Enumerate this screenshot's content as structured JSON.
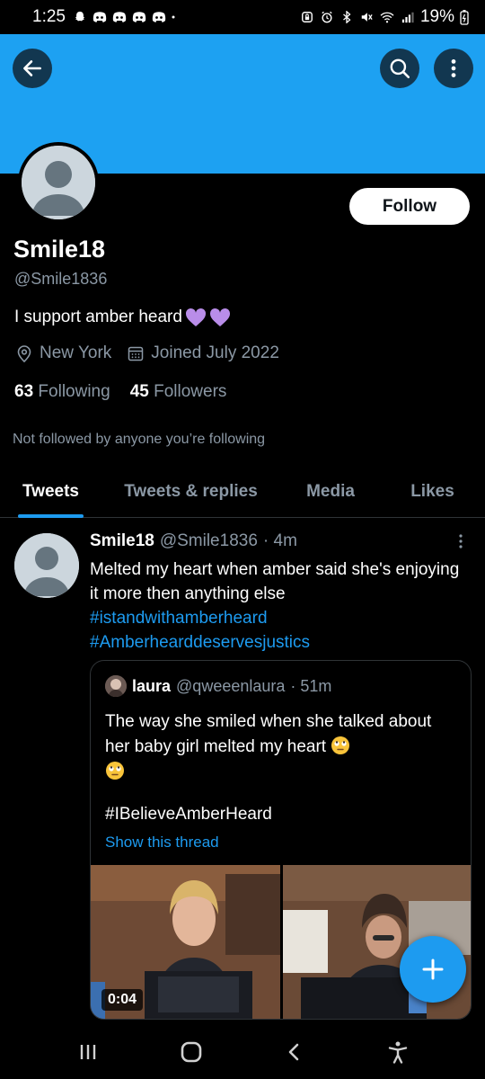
{
  "status_bar": {
    "time": "1:25",
    "battery": "19%",
    "icons": [
      "snapchat-icon",
      "discord-icon",
      "discord-icon",
      "discord-icon",
      "discord-icon",
      "dot-icon",
      "lock-icon",
      "alarm-icon",
      "bluetooth-icon",
      "mute-icon",
      "wifi-icon",
      "signal-icon",
      "battery-charging-icon"
    ]
  },
  "header": {
    "back_icon": "arrow-left-icon",
    "search_icon": "search-icon",
    "more_icon": "more-vertical-icon",
    "banner_color": "#1da1f2"
  },
  "profile": {
    "name": "Smile18",
    "handle": "@Smile1836",
    "bio": "I support amber heard",
    "bio_emojis": [
      "purple-heart",
      "purple-heart"
    ],
    "location": "New York",
    "joined": "Joined July 2022",
    "following_count": "63",
    "following_label": "Following",
    "followers_count": "45",
    "followers_label": "Followers",
    "not_followed_text": "Not followed by anyone you’re following",
    "follow_label": "Follow"
  },
  "tabs": [
    {
      "label": "Tweets",
      "active": true
    },
    {
      "label": "Tweets & replies",
      "active": false
    },
    {
      "label": "Media",
      "active": false
    },
    {
      "label": "Likes",
      "active": false
    }
  ],
  "tweet": {
    "name": "Smile18",
    "handle": "@Smile1836",
    "time": "· 4m",
    "text": "Melted my heart when amber said she's enjoying it more then anything else",
    "hashtags": [
      "#istandwithamberheard",
      "#Amberhearddeservesjustics"
    ],
    "quote": {
      "name": "laura",
      "handle": "@qweeenlaura",
      "time": "· 51m",
      "text": "The way she smiled when she talked about her baby girl melted my heart",
      "emojis": [
        "rolling-eyes-face",
        "rolling-eyes-face"
      ],
      "hashtag": "#IBelieveAmberHeard",
      "show_thread": "Show this thread",
      "video_duration": "0:04"
    }
  },
  "fab": {
    "icon": "plus-icon"
  },
  "nav_bar": {
    "icons": [
      "recent-apps-icon",
      "home-icon",
      "back-icon",
      "accessibility-icon"
    ]
  },
  "colors": {
    "accent": "#1d9bf0",
    "secondary_text": "#8b98a5",
    "border": "#2f3336",
    "background": "#000000",
    "heart": "#b98de9"
  }
}
